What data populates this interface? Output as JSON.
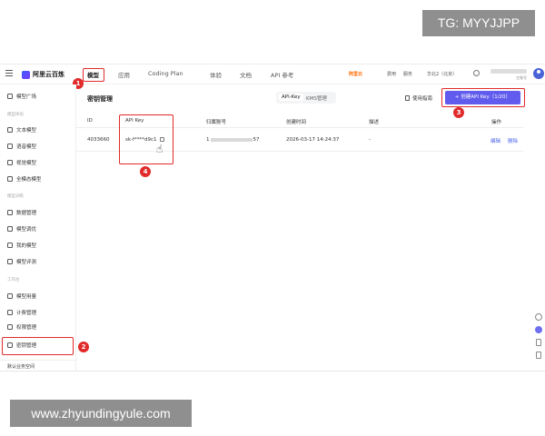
{
  "watermark_top": "TG: MYYJJPP",
  "watermark_bottom": "www.zhyundingyule.com",
  "topnav": {
    "logo": "阿里云百炼",
    "tabs": [
      "模型",
      "应用",
      "Coding Plan",
      "体验",
      "文档",
      "API 参考"
    ],
    "right": {
      "aliyun": "阿里云",
      "fee": "费用",
      "service": "服务",
      "region": "华北2（北京）",
      "user_sub": "主账号"
    }
  },
  "sidebar": {
    "items_top": [
      {
        "label": "模型广场",
        "icon": "model-square-icon"
      }
    ],
    "section1": "模型体验",
    "section1_items": [
      {
        "label": "文本模型",
        "icon": "text-icon"
      },
      {
        "label": "语音模型",
        "icon": "voice-icon"
      },
      {
        "label": "视觉模型",
        "icon": "vision-icon"
      },
      {
        "label": "全模态模型",
        "icon": "omni-icon"
      }
    ],
    "section2": "模型训练",
    "section2_items": [
      {
        "label": "数据管理",
        "icon": "data-icon"
      },
      {
        "label": "模型调优",
        "icon": "tune-icon"
      },
      {
        "label": "我的模型",
        "icon": "my-model-icon"
      },
      {
        "label": "模型评测",
        "icon": "eval-icon"
      }
    ],
    "section3": "工作台",
    "section3_items": [
      {
        "label": "模型用量",
        "icon": "usage-icon"
      },
      {
        "label": "计费管理",
        "icon": "billing-icon"
      },
      {
        "label": "权限管理",
        "icon": "permission-icon"
      },
      {
        "label": "密钥管理",
        "icon": "key-icon"
      }
    ],
    "workspace": "默认业务空间"
  },
  "main": {
    "title": "密钥管理",
    "segment": [
      "API-Key",
      "KMS管理"
    ],
    "doc_link": "使用指南",
    "create_button": "+ 创建API Key（1/20）",
    "columns": [
      "ID",
      "API Key",
      "归属账号",
      "创建时间",
      "描述",
      "操作"
    ],
    "row": {
      "id": "4033660",
      "api_key": "sk-f****d9c1",
      "account_prefix": "1",
      "account_suffix": "57",
      "created": "2026-03-17 14:24:37",
      "desc": "-",
      "edit": "编辑",
      "delete": "删除"
    }
  },
  "annotations": [
    "1",
    "2",
    "3",
    "4"
  ]
}
